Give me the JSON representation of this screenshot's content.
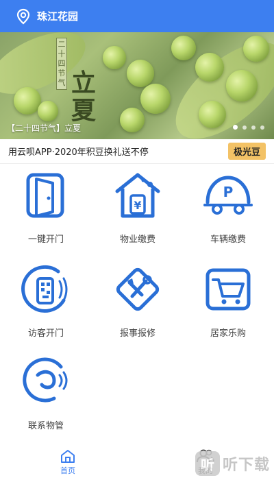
{
  "header": {
    "title": "珠江花园",
    "icon": "location-pin-icon"
  },
  "banner": {
    "vertical_text": "二十四节气",
    "big_chars": [
      "立",
      "夏"
    ],
    "caption": "【二十四节气】立夏",
    "dots_count": 4,
    "active_dot": 0
  },
  "notice": {
    "text": "用云呗APP·2020年积豆换礼送不停",
    "badge": "极光豆"
  },
  "grid": [
    {
      "label": "一键开门",
      "icon": "door-icon"
    },
    {
      "label": "物业缴费",
      "icon": "property-fee-icon"
    },
    {
      "label": "车辆缴费",
      "icon": "parking-fee-icon"
    },
    {
      "label": "访客开门",
      "icon": "visitor-qr-icon"
    },
    {
      "label": "报事报修",
      "icon": "repair-tools-icon"
    },
    {
      "label": "居家乐购",
      "icon": "shopping-cart-icon"
    },
    {
      "label": "联系物管",
      "icon": "contact-management-icon"
    }
  ],
  "bottom_nav": [
    {
      "label": "首页",
      "icon": "home-icon",
      "active": true
    },
    {
      "label": "我的",
      "icon": "profile-icon",
      "active": false
    }
  ],
  "watermark": {
    "logo_char": "听",
    "text": "听下载"
  },
  "colors": {
    "primary": "#3d7ff0",
    "icon_blue": "#2a6fd6",
    "badge_bg": "#f3c266"
  }
}
